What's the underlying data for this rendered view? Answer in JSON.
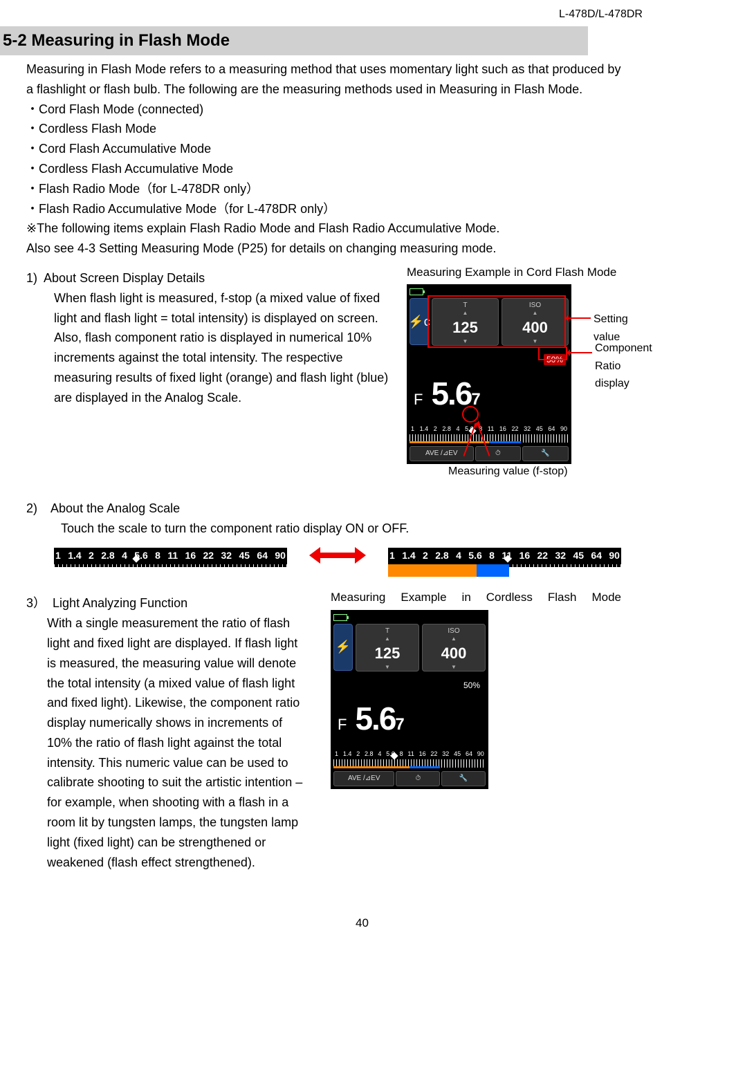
{
  "header": {
    "model": "L-478D/L-478DR"
  },
  "section": {
    "heading": "5-2 Measuring in Flash Mode",
    "intro": "Measuring in Flash Mode refers to a measuring method that uses momentary light such as that produced by a flashlight or flash bulb. The following are the measuring methods used in Measuring in Flash Mode.",
    "bullets": [
      "・Cord Flash Mode (connected)",
      "・Cordless Flash Mode",
      "・Cord Flash Accumulative Mode",
      "・Cordless Flash Accumulative Mode",
      "・Flash Radio Mode（for L-478DR only）",
      "・Flash Radio Accumulative Mode（for L-478DR only）"
    ],
    "note": "※The following items explain Flash Radio Mode and Flash Radio Accumulative Mode.",
    "crossref": "Also see 4-3 Setting Measuring Mode (P25) for details on changing measuring mode."
  },
  "item1": {
    "num": "1)",
    "title": "About Screen Display Details",
    "body": "When flash light is measured, f-stop (a mixed value of fixed light and flash light = total intensity) is displayed on screen. Also, flash component ratio is displayed in numerical 10% increments against the total intensity. The respective measuring results of fixed light (orange) and flash light (blue) are displayed in the Analog Scale.",
    "fig_title": "Measuring Example in Cord Flash Mode",
    "callout_setting": "Setting value",
    "callout_ratio1": "Component",
    "callout_ratio2": "Ratio display",
    "callout_fstop": "Measuring value (f-stop)"
  },
  "device": {
    "mode_glyph": "⚡c",
    "t_label": "T",
    "iso_label": "ISO",
    "t_value": "125",
    "iso_value": "400",
    "ratio_value": "50%",
    "f_label": "F",
    "f_main": "5.6",
    "f_sub": "7",
    "scale_labels": [
      "1",
      "1.4",
      "2",
      "2.8",
      "4",
      "5.6",
      "8",
      "11",
      "16",
      "22",
      "32",
      "45",
      "64",
      "90"
    ],
    "btn_ave": "AVE /⊿EV",
    "btn_mid": "⏱",
    "btn_tool": "🔧"
  },
  "item2": {
    "num": "2)",
    "title": "About the Analog Scale",
    "body": "Touch the scale to turn the component ratio display ON or OFF.",
    "scale_labels": [
      "1",
      "1.4",
      "2",
      "2.8",
      "4",
      "5.6",
      "8",
      "11",
      "16",
      "22",
      "32",
      "45",
      "64",
      "90"
    ]
  },
  "item3": {
    "num": "3）",
    "title": "Light Analyzing Function",
    "body": "With a single measurement the ratio of flash light and fixed light are displayed. If flash light is measured, the measuring value will denote the total intensity (a mixed value of flash light and fixed light). Likewise, the component ratio display numerically shows in increments of 10% the ratio of flash light against the total intensity. This numeric value can be used to calibrate shooting to suit the artistic intention – for example, when shooting with a flash in a room lit by tungsten lamps, the tungsten lamp light (fixed light) can be strengthened or weakened (flash effect strengthened).",
    "fig_title": "Measuring  Example  in  Cordless  Flash Mode"
  },
  "device2": {
    "mode_glyph": "⚡",
    "t_label": "T",
    "iso_label": "ISO",
    "t_value": "125",
    "iso_value": "400",
    "ratio_value": "50%",
    "f_label": "F",
    "f_main": "5.6",
    "f_sub": "7",
    "btn_ave": "AVE /⊿EV",
    "btn_mid": "⏱",
    "btn_tool": "🔧"
  },
  "page_number": "40"
}
